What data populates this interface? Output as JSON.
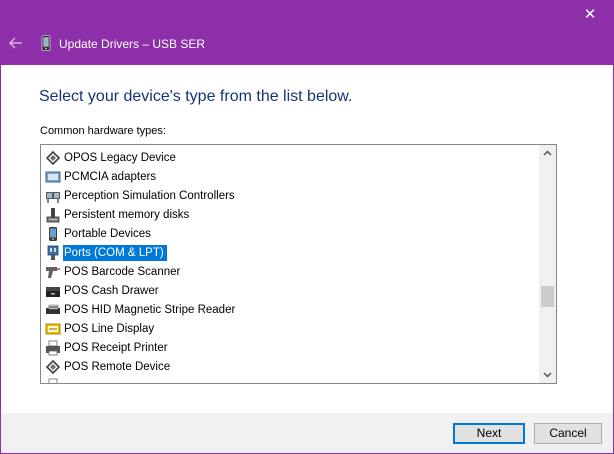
{
  "window": {
    "title": "Update Drivers – USB SER",
    "close_glyph": "✕",
    "back_icon": "back-arrow-icon",
    "title_icon": "phone-device-icon"
  },
  "content": {
    "heading": "Select your device's type from the list below.",
    "list_label": "Common hardware types:"
  },
  "hardware_types": [
    {
      "label": "OPOS Legacy Device",
      "icon": "opos-legacy-icon",
      "selected": false
    },
    {
      "label": "PCMCIA adapters",
      "icon": "pcmcia-icon",
      "selected": false
    },
    {
      "label": "Perception Simulation Controllers",
      "icon": "perception-controller-icon",
      "selected": false
    },
    {
      "label": "Persistent memory disks",
      "icon": "memory-disk-icon",
      "selected": false
    },
    {
      "label": "Portable Devices",
      "icon": "portable-device-icon",
      "selected": false
    },
    {
      "label": "Ports (COM & LPT)",
      "icon": "port-icon",
      "selected": true
    },
    {
      "label": "POS Barcode Scanner",
      "icon": "barcode-scanner-icon",
      "selected": false
    },
    {
      "label": "POS Cash Drawer",
      "icon": "cash-drawer-icon",
      "selected": false
    },
    {
      "label": "POS HID Magnetic Stripe Reader",
      "icon": "stripe-reader-icon",
      "selected": false
    },
    {
      "label": "POS Line Display",
      "icon": "line-display-icon",
      "selected": false
    },
    {
      "label": "POS Receipt Printer",
      "icon": "receipt-printer-icon",
      "selected": false
    },
    {
      "label": "POS Remote Device",
      "icon": "remote-device-icon",
      "selected": false
    },
    {
      "label": "",
      "icon": "printer-icon",
      "selected": false
    }
  ],
  "buttons": {
    "next": "Next",
    "cancel": "Cancel"
  },
  "colors": {
    "titlebar": "#8c2fa8",
    "heading": "#16337a",
    "selection": "#0078d7"
  }
}
